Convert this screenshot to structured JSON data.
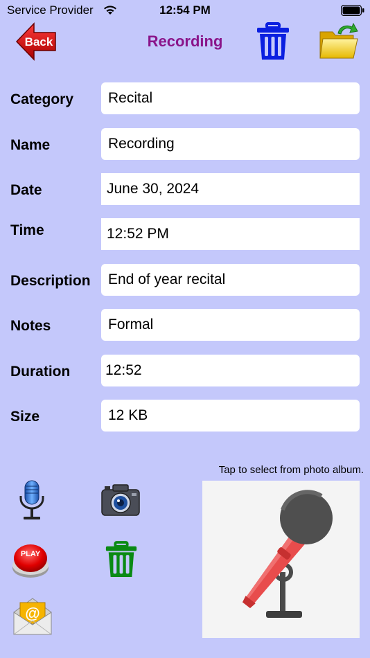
{
  "status_bar": {
    "carrier": "Service Provider",
    "time": "12:54 PM"
  },
  "nav": {
    "back_label": "Back",
    "title": "Recording",
    "delete_icon": "trash-icon",
    "folder_icon": "folder-icon"
  },
  "form": {
    "category": {
      "label": "Category",
      "value": "Recital"
    },
    "name": {
      "label": "Name",
      "value": "Recording"
    },
    "date": {
      "label": "Date",
      "value": "June 30, 2024"
    },
    "time": {
      "label": "Time",
      "value": "12:52 PM"
    },
    "description": {
      "label": "Description",
      "value": "End of year recital"
    },
    "notes": {
      "label": "Notes",
      "value": "Formal"
    },
    "duration": {
      "label": "Duration",
      "value": "12:52"
    },
    "size": {
      "label": "Size",
      "value": "12 KB"
    }
  },
  "actions": {
    "record_icon": "microphone-icon",
    "camera_icon": "camera-icon",
    "play_label": "PLAY",
    "delete_icon": "green-trash-icon",
    "email_icon": "email-icon"
  },
  "photo": {
    "hint": "Tap to select from photo album.",
    "image_icon": "microphone-image"
  },
  "colors": {
    "background": "#c4c8fb",
    "title": "#8a158a",
    "delete_blue": "#0a1fe0",
    "delete_green": "#0a8a14"
  }
}
